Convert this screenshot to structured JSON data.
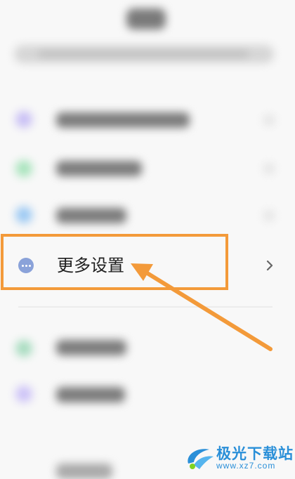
{
  "highlighted_item": {
    "label": "更多设置",
    "icon": "more-dots-icon",
    "chevron": "chevron-right-icon"
  },
  "annotation": {
    "box_color": "#f39a3a",
    "arrow_color": "#f39a3a"
  },
  "watermark": {
    "title": "极光下载站",
    "url": "www.xz7.com"
  },
  "colors": {
    "accent_orange": "#f39a3a",
    "more_icon_bg": "#8aa2d9",
    "watermark_blue": "#2a8fd8"
  }
}
